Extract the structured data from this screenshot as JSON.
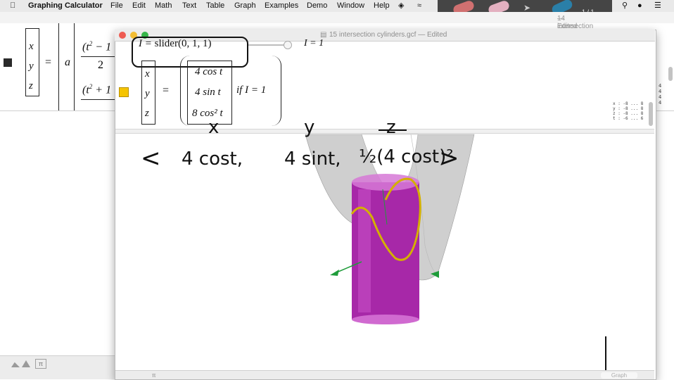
{
  "menubar": {
    "app_name": "Graphing Calculator",
    "items": [
      "File",
      "Edit",
      "Math",
      "Text",
      "Table",
      "Graph",
      "Examples",
      "Demo",
      "Window",
      "Help"
    ]
  },
  "back_window": {
    "title": "14 intersection cone plane.gcf",
    "edited": "— Edited",
    "equation": {
      "lhs": [
        "x",
        "y",
        "z"
      ],
      "coef": "a"
    },
    "right_margin_values": [
      "4",
      "4",
      "4",
      "4"
    ]
  },
  "front_window": {
    "title": "15 intersection cylinders.gcf",
    "edited": "— Edited",
    "slider_eq": {
      "var": "I",
      "func": "slider(0, 1, 1)",
      "value": "I = 1"
    },
    "equation": {
      "lhs": [
        "x",
        "y",
        "z"
      ],
      "rhs": [
        "4 cos t",
        "4 sin t",
        "8 cos² t"
      ],
      "condition": "if I = 1"
    },
    "axis_ranges": [
      "x : -8 ... 8",
      "y : -8 ... 8",
      "z : -8 ... 8",
      "t : -6 ... 6"
    ],
    "graph_button": "Graph"
  },
  "handwriting": {
    "labels": [
      "x",
      "y",
      "z"
    ],
    "vector": [
      "<",
      "4 cost,",
      "4 sint,",
      "½(4 cost)²",
      ">"
    ]
  },
  "page_indicator": "1 / 1",
  "colors": {
    "cylinder": "#b52fb5",
    "parabolic_surface": "#c9c9c9",
    "curve": "#d4b000",
    "accent_yellow": "#f5c400"
  }
}
